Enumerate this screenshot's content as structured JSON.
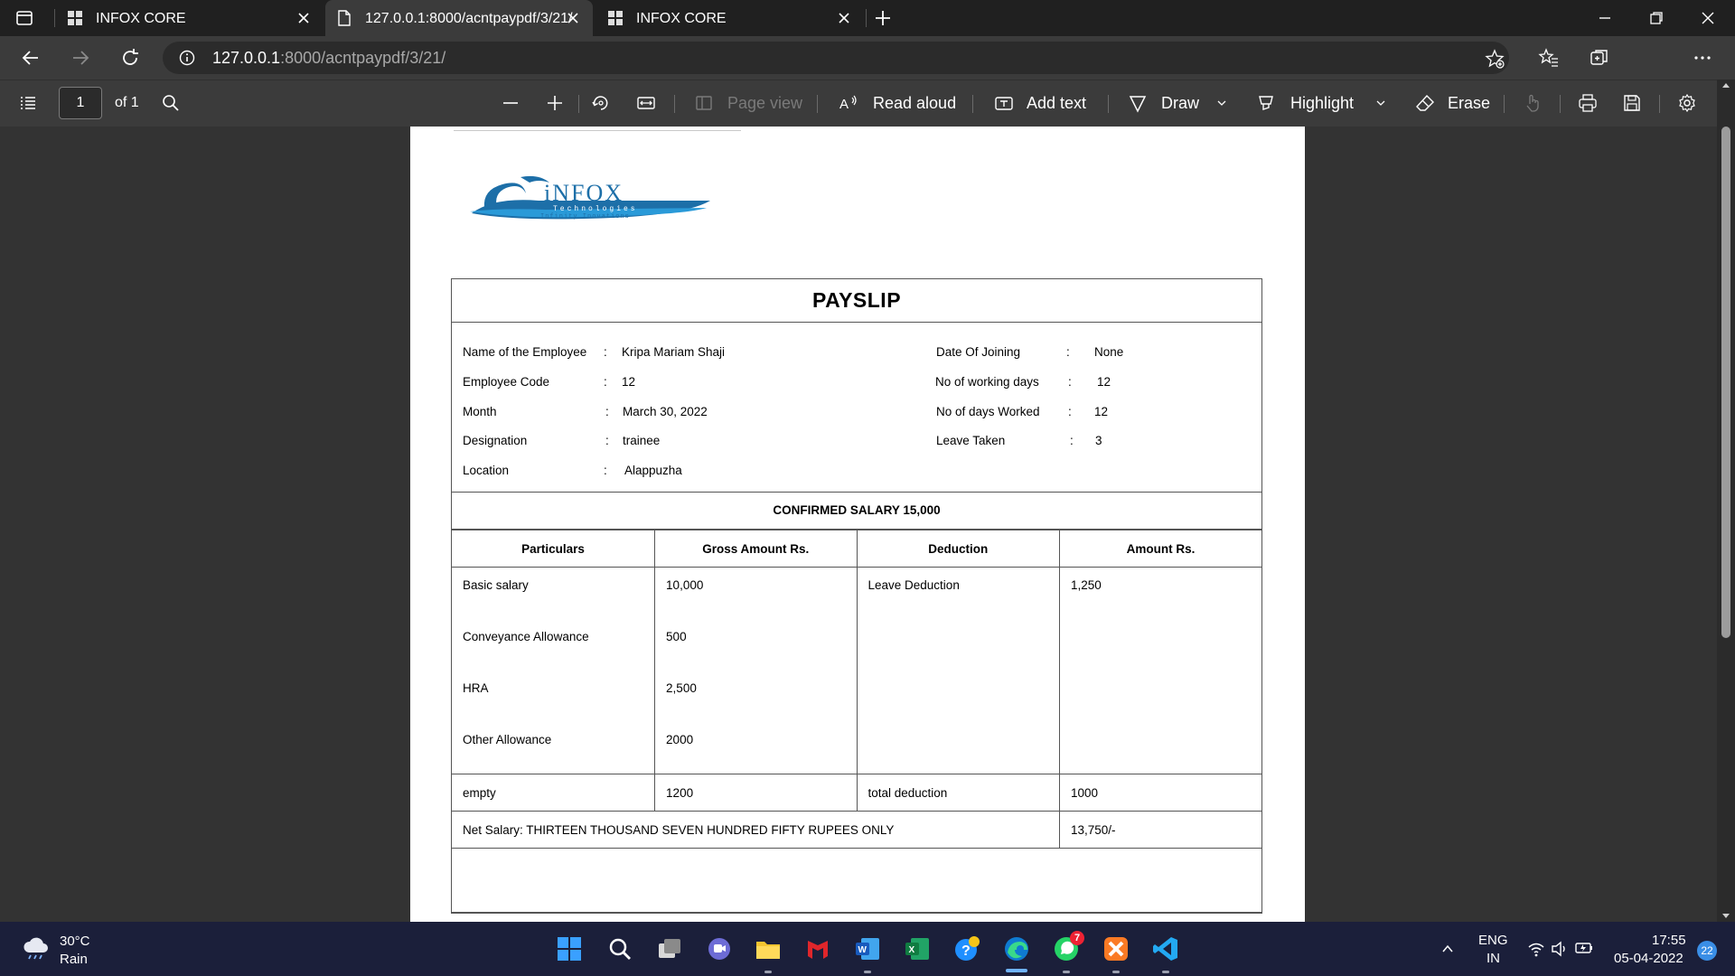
{
  "browser": {
    "tabs": [
      {
        "title": "INFOX CORE",
        "active": false
      },
      {
        "title": "127.0.0.1:8000/acntpaypdf/3/21/",
        "active": true
      },
      {
        "title": "INFOX CORE",
        "active": false
      }
    ],
    "url_host": "127.0.0.1",
    "url_rest": ":8000/acntpaypdf/3/21/"
  },
  "pdf_toolbar": {
    "page_number": "1",
    "page_of": "of 1",
    "page_view": "Page view",
    "read_aloud": "Read aloud",
    "add_text": "Add text",
    "draw": "Draw",
    "highlight": "Highlight",
    "erase": "Erase"
  },
  "payslip": {
    "title": "PAYSLIP",
    "left": [
      {
        "label": "Name of the Employee",
        "value": "Kripa Mariam Shaji"
      },
      {
        "label": "Employee Code",
        "value": "12"
      },
      {
        "label": "Month",
        "value": "March 30, 2022"
      },
      {
        "label": "Designation",
        "value": "trainee"
      },
      {
        "label": "Location",
        "value": "Alappuzha"
      }
    ],
    "right": [
      {
        "label": "Date Of Joining",
        "value": "None"
      },
      {
        "label": "No of working days",
        "value": "12"
      },
      {
        "label": "No of days Worked",
        "value": "12"
      },
      {
        "label": "Leave Taken",
        "value": "3"
      }
    ],
    "colon": ":",
    "confirmed_salary": "CONFIRMED SALARY 15,000",
    "headers": [
      "Particulars",
      "Gross Amount Rs.",
      "Deduction",
      "Amount Rs."
    ],
    "earnings": [
      {
        "name": "Basic salary",
        "amount": "10,000"
      },
      {
        "name": "Conveyance Allowance",
        "amount": "500"
      },
      {
        "name": "HRA",
        "amount": "2,500"
      },
      {
        "name": "Other Allowance",
        "amount": "2000"
      }
    ],
    "deductions": [
      {
        "name": "Leave Deduction",
        "amount": "1,250"
      }
    ],
    "totals": {
      "label": "empty",
      "gross": "1200",
      "deduction_label": "total deduction",
      "deduction": "1000"
    },
    "net_salary_text": "Net Salary: THIRTEEN THOUSAND SEVEN HUNDRED FIFTY RUPEES ONLY",
    "net_salary_amount": "13,750/-"
  },
  "taskbar": {
    "weather_temp": "30°C",
    "weather_desc": "Rain",
    "language": "ENG",
    "region": "IN",
    "time": "17:55",
    "date": "05-04-2022",
    "notification_count": "22",
    "whatsapp_badge": "7"
  }
}
